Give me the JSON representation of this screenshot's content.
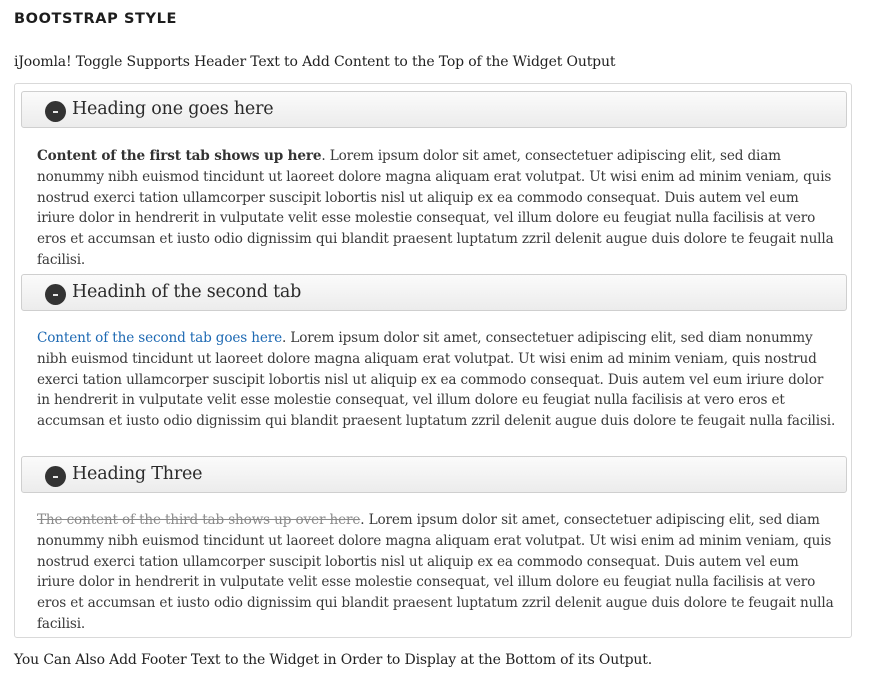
{
  "page": {
    "title": "BOOTSTRAP STYLE",
    "header_text": "iJoomla! Toggle Supports Header Text to Add Content to the Top of the Widget Output",
    "footer_text": "You Can Also Add Footer Text to the Widget in Order to Display at the Bottom of its Output."
  },
  "accordion": {
    "icon": "minus-circle-icon",
    "panels": [
      {
        "heading": "Heading one goes here",
        "lead": "Content of the first tab shows up here",
        "lead_style": "bold",
        "body": ". Lorem ipsum dolor sit amet, consectetuer adipiscing elit, sed diam nonummy nibh euismod tincidunt ut laoreet dolore magna aliquam erat volutpat. Ut wisi enim ad minim veniam, quis nostrud exerci tation ullamcorper suscipit lobortis nisl ut aliquip ex ea commodo consequat. Duis autem vel eum iriure dolor in hendrerit in vulputate velit esse molestie consequat, vel illum dolore eu feugiat nulla facilisis at vero eros et accumsan et iusto odio dignissim qui blandit praesent luptatum zzril delenit augue duis dolore te feugait nulla facilisi."
      },
      {
        "heading": "Headinh of the second tab",
        "lead": "Content of the second tab goes here",
        "lead_style": "link",
        "body": ". Lorem ipsum dolor sit amet, consectetuer adipiscing elit, sed diam nonummy nibh euismod tincidunt ut laoreet dolore magna aliquam erat volutpat. Ut wisi enim ad minim veniam, quis nostrud exerci tation ullamcorper suscipit lobortis nisl ut aliquip ex ea commodo consequat. Duis autem vel eum iriure dolor in hendrerit in vulputate velit esse molestie consequat, vel illum dolore eu feugiat nulla facilisis at vero eros et accumsan et iusto odio dignissim qui blandit praesent luptatum zzril delenit augue duis dolore te feugait nulla facilisi."
      },
      {
        "heading": "Heading Three",
        "lead": "The content of the third tab shows up over here",
        "lead_style": "strikethrough",
        "body": ". Lorem ipsum dolor sit amet, consectetuer adipiscing elit, sed diam nonummy nibh euismod tincidunt ut laoreet dolore magna aliquam erat volutpat. Ut wisi enim ad minim veniam, quis nostrud exerci tation ullamcorper suscipit lobortis nisl ut aliquip ex ea commodo consequat. Duis autem vel eum iriure dolor in hendrerit in vulputate velit esse molestie consequat, vel illum dolore eu feugiat nulla facilisis at vero eros et accumsan et iusto odio dignissim qui blandit praesent luptatum zzril delenit augue duis dolore te feugait nulla facilisi."
      }
    ]
  },
  "colors": {
    "link": "#1d69b3",
    "icon_background": "#333333",
    "heading_background": "#efefef",
    "border": "#d9d9d9"
  }
}
